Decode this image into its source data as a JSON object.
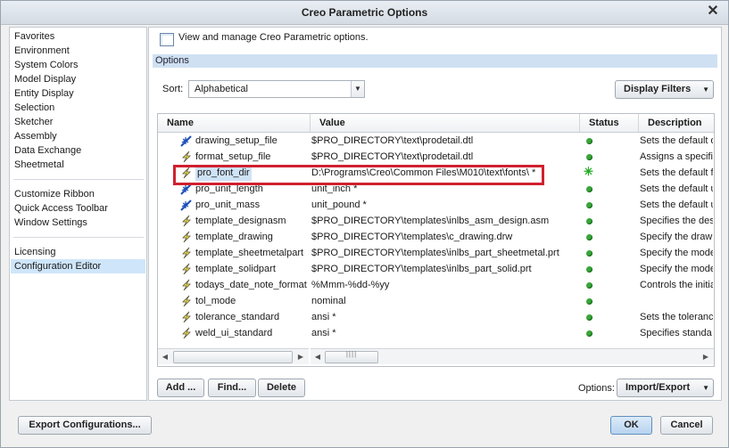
{
  "window": {
    "title": "Creo Parametric Options"
  },
  "sidebar": {
    "group1": [
      "Favorites",
      "Environment",
      "System Colors",
      "Model Display",
      "Entity Display",
      "Selection",
      "Sketcher",
      "Assembly",
      "Data Exchange",
      "Sheetmetal"
    ],
    "group2": [
      "Customize Ribbon",
      "Quick Access Toolbar",
      "Window Settings"
    ],
    "group3": [
      "Licensing",
      "Configuration Editor"
    ],
    "selected": "Configuration Editor"
  },
  "header": {
    "text": "View and manage Creo Parametric options.",
    "section": "Options"
  },
  "sort": {
    "label": "Sort:",
    "value": "Alphabetical"
  },
  "display_filters": "Display Filters",
  "table": {
    "columns": [
      "Name",
      "Value",
      "Status",
      "Description"
    ],
    "rows": [
      {
        "name": "drawing_setup_file",
        "value": "$PRO_DIRECTORY\\text\\prodetail.dtl",
        "desc": "Sets the default d",
        "icon": "blue-star",
        "status": "dot"
      },
      {
        "name": "format_setup_file",
        "value": "$PRO_DIRECTORY\\text\\prodetail.dtl",
        "desc": "Assigns a specifi",
        "icon": "lightning",
        "status": "dot"
      },
      {
        "name": "pro_font_dir",
        "value": "D:\\Programs\\Creo\\Common Files\\M010\\text\\fonts\\ *",
        "desc": "Sets the default f",
        "icon": "lightning",
        "status": "star"
      },
      {
        "name": "pro_unit_length",
        "value": "unit_inch *",
        "desc": "Sets the default u",
        "icon": "blue-star",
        "status": "dot"
      },
      {
        "name": "pro_unit_mass",
        "value": "unit_pound *",
        "desc": "Sets the default u",
        "icon": "blue-star",
        "status": "dot"
      },
      {
        "name": "template_designasm",
        "value": "$PRO_DIRECTORY\\templates\\inlbs_asm_design.asm",
        "desc": "Specifies the des",
        "icon": "lightning",
        "status": "dot"
      },
      {
        "name": "template_drawing",
        "value": "$PRO_DIRECTORY\\templates\\c_drawing.drw",
        "desc": "Specify the draw",
        "icon": "lightning",
        "status": "dot"
      },
      {
        "name": "template_sheetmetalpart",
        "value": "$PRO_DIRECTORY\\templates\\inlbs_part_sheetmetal.prt",
        "desc": "Specify the mode",
        "icon": "lightning",
        "status": "dot"
      },
      {
        "name": "template_solidpart",
        "value": "$PRO_DIRECTORY\\templates\\inlbs_part_solid.prt",
        "desc": "Specify the mode",
        "icon": "lightning",
        "status": "dot"
      },
      {
        "name": "todays_date_note_format",
        "value": "%Mmm-%dd-%yy",
        "desc": "Controls the initia",
        "icon": "lightning",
        "status": "dot"
      },
      {
        "name": "tol_mode",
        "value": "nominal",
        "desc": "",
        "icon": "lightning",
        "status": "dot"
      },
      {
        "name": "tolerance_standard",
        "value": "ansi *",
        "desc": "Sets the toleranc",
        "icon": "lightning",
        "status": "dot"
      },
      {
        "name": "weld_ui_standard",
        "value": "ansi *",
        "desc": "Specifies standa",
        "icon": "lightning",
        "status": "dot"
      }
    ]
  },
  "buttons": {
    "add": "Add ...",
    "find": "Find...",
    "delete": "Delete",
    "options_label": "Options:",
    "import_export": "Import/Export"
  },
  "footer": {
    "export": "Export Configurations...",
    "ok": "OK",
    "cancel": "Cancel"
  },
  "colors": {
    "highlight": "#d0202f",
    "status_green": "#3aa63a",
    "selection": "#cfe6fa"
  }
}
